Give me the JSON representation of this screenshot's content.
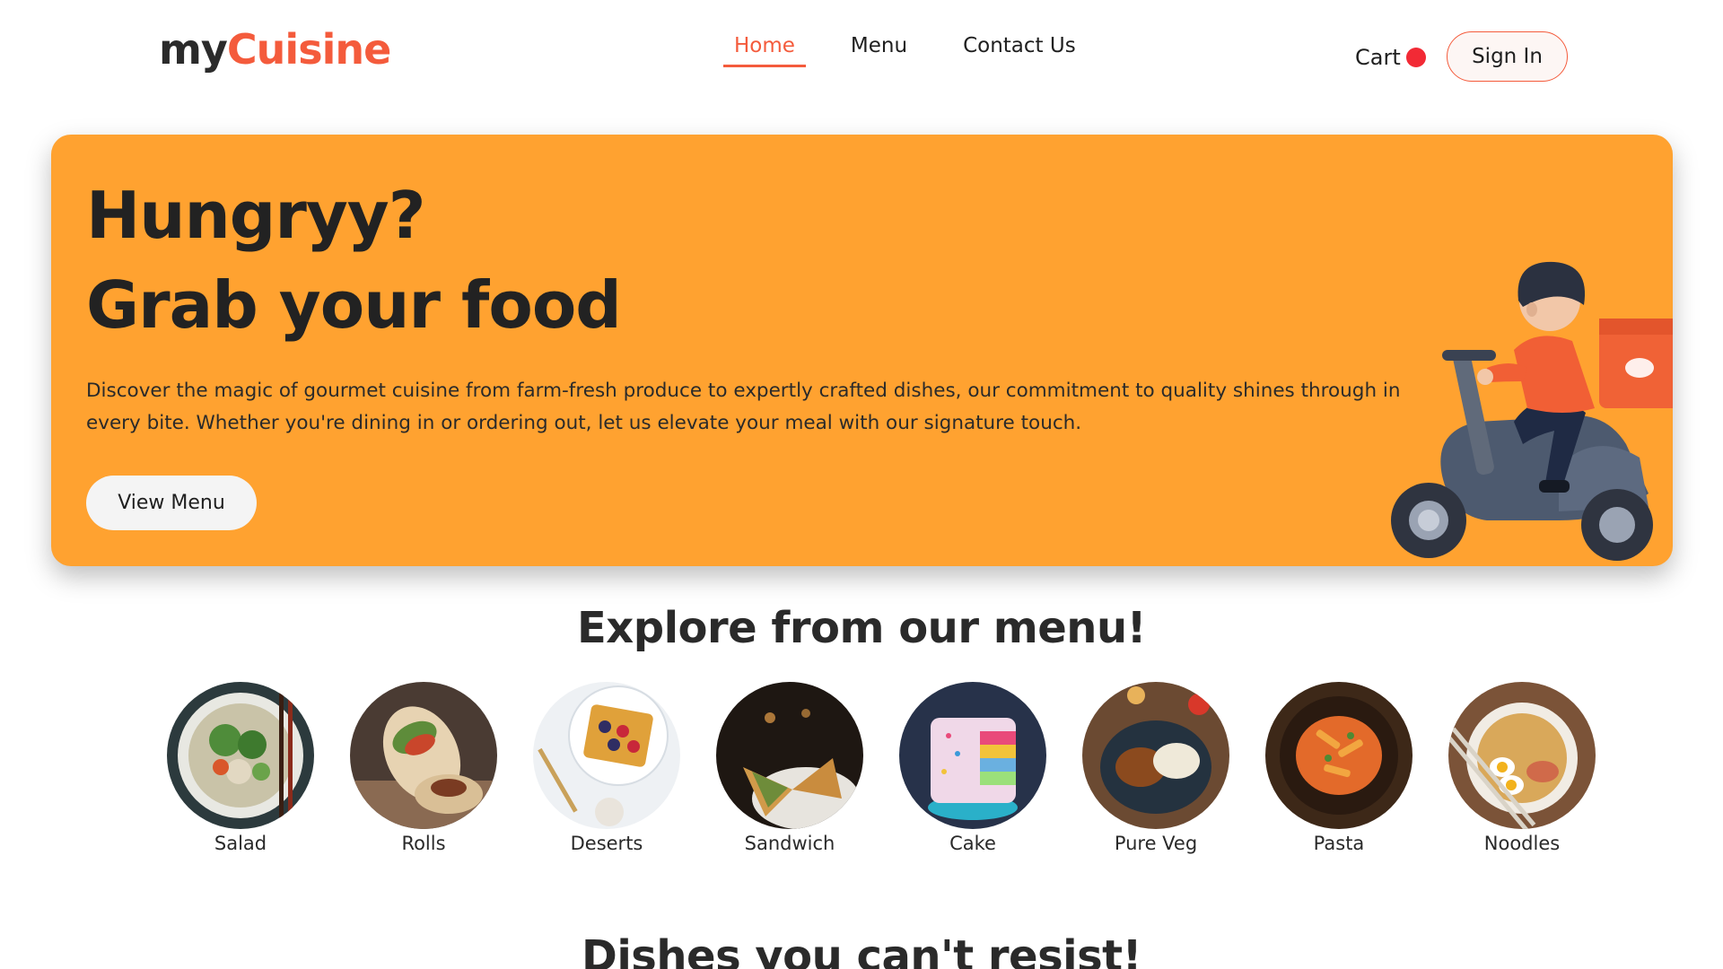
{
  "header": {
    "logo_part1": "my",
    "logo_part2": "Cuisine",
    "nav": [
      "Home",
      "Menu",
      "Contact Us"
    ],
    "active_nav": "Home",
    "cart_label": "Cart",
    "signin_label": "Sign In"
  },
  "hero": {
    "title_line1": "Hungryy?",
    "title_line2": "Grab your food",
    "description": "Discover the magic of gourmet cuisine from farm-fresh produce to expertly crafted dishes, our commitment to quality shines through in every bite. Whether you're dining in or ordering out, let us elevate your meal with our signature touch.",
    "button_label": "View Menu"
  },
  "explore": {
    "title": "Explore from our menu!",
    "items": [
      {
        "label": "Salad"
      },
      {
        "label": "Rolls"
      },
      {
        "label": "Deserts"
      },
      {
        "label": "Sandwich"
      },
      {
        "label": "Cake"
      },
      {
        "label": "Pure Veg"
      },
      {
        "label": "Pasta"
      },
      {
        "label": "Noodles"
      }
    ]
  },
  "dishes": {
    "title": "Dishes you can't resist!"
  },
  "colors": {
    "accent": "#f45b3c",
    "hero_bg": "#ffa230",
    "cart_dot": "#f22a35"
  }
}
